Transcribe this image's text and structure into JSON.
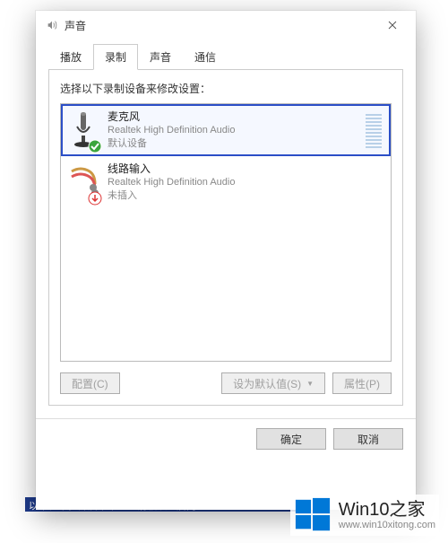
{
  "dialog": {
    "title": "声音",
    "prompt": "选择以下录制设备来修改设置：",
    "tabs": [
      {
        "label": "播放"
      },
      {
        "label": "录制"
      },
      {
        "label": "声音"
      },
      {
        "label": "通信"
      }
    ],
    "active_tab_index": 1,
    "devices": [
      {
        "name": "麦克风",
        "description": "Realtek High Definition Audio",
        "status": "默认设备",
        "status_kind": "default",
        "selected": true
      },
      {
        "name": "线路输入",
        "description": "Realtek High Definition Audio",
        "status": "未插入",
        "status_kind": "unplugged",
        "selected": false
      }
    ],
    "buttons": {
      "configure": "配置(C)",
      "set_default": "设为默认值(S)",
      "properties": "属性(P)",
      "ok": "确定",
      "cancel": "取消"
    }
  },
  "watermark": {
    "title": "Win10之家",
    "url": "www.win10xitong.com"
  },
  "blue_strip": "以米住下，开启不来为态消吸纹入居内正"
}
